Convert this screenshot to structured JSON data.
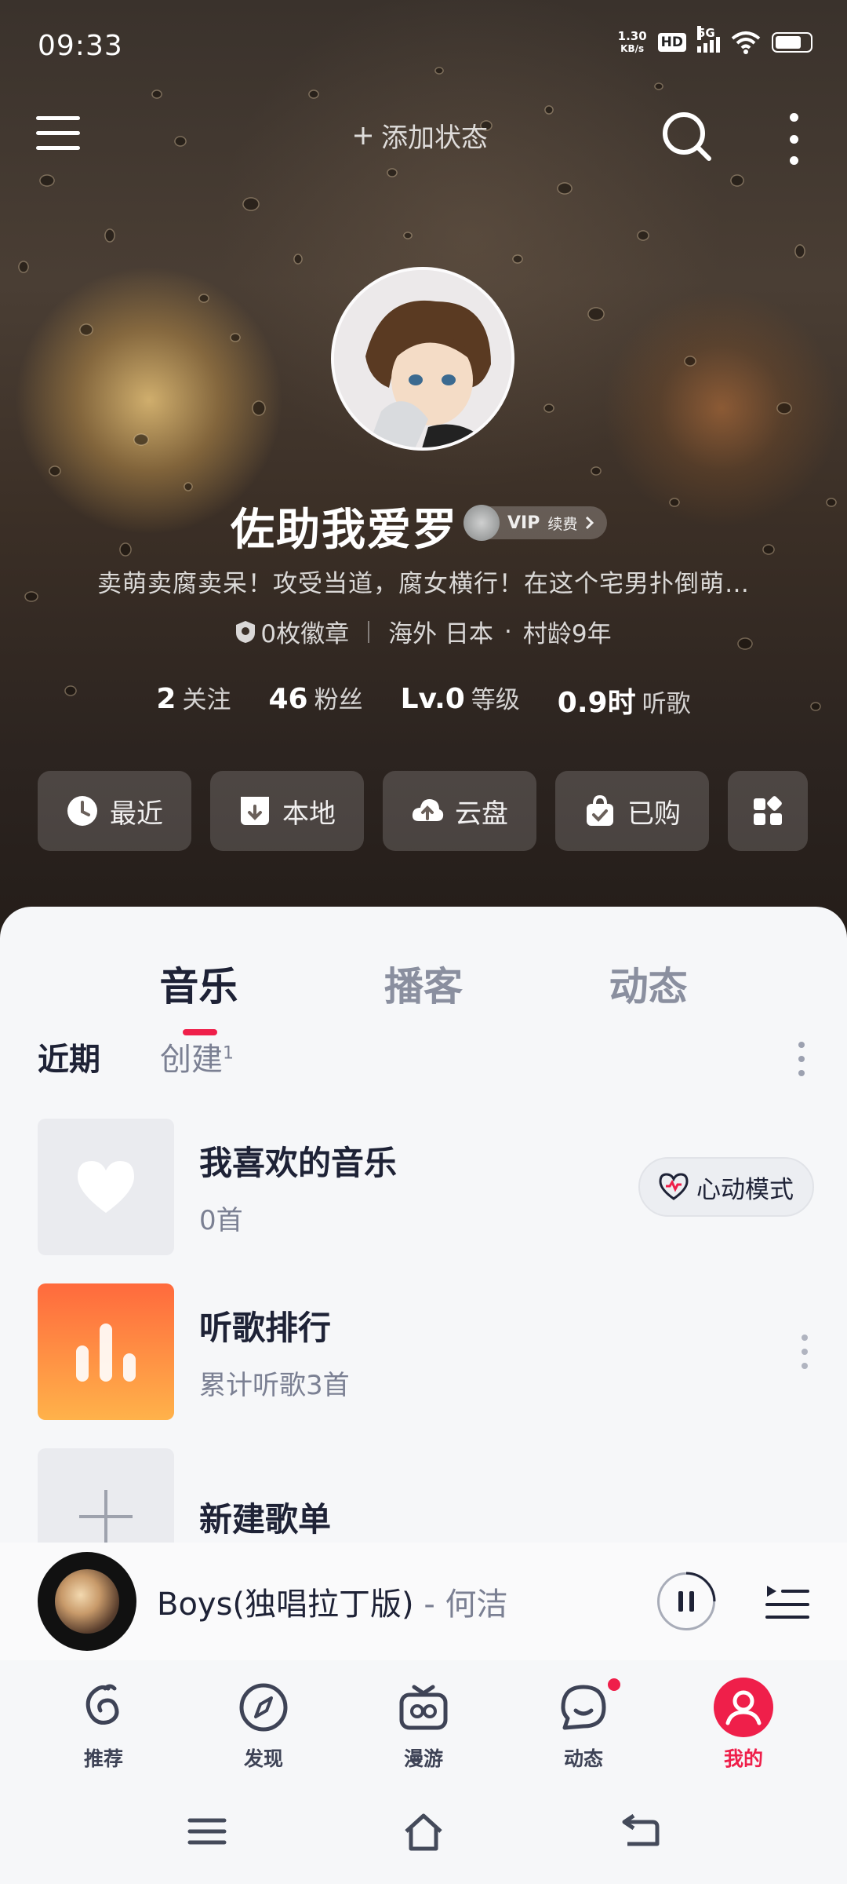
{
  "status_bar": {
    "time": "09:33",
    "net_speed_value": "1.30",
    "net_speed_unit": "KB/s",
    "hd": "HD",
    "network": "5G"
  },
  "top_bar": {
    "add_status_label": "添加状态"
  },
  "profile": {
    "username": "佐助我爱罗",
    "vip_label": "VIP",
    "vip_renew": "续费",
    "bio": "卖萌卖腐卖呆！攻受当道，腐女横行！在这个宅男扑倒萌…",
    "badges": "0枚徽章",
    "location": "海外 日本",
    "age": "村龄9年",
    "stats": [
      {
        "num": "2",
        "label": "关注"
      },
      {
        "num": "46",
        "label": "粉丝"
      },
      {
        "num": "Lv.0",
        "label": "等级"
      },
      {
        "num": "0.9时",
        "label": "听歌"
      }
    ]
  },
  "quick_actions": [
    {
      "label": "最近",
      "icon": "clock-icon"
    },
    {
      "label": "本地",
      "icon": "download-icon"
    },
    {
      "label": "云盘",
      "icon": "cloud-upload-icon"
    },
    {
      "label": "已购",
      "icon": "shopping-bag-icon"
    }
  ],
  "tabs": [
    "音乐",
    "播客",
    "动态"
  ],
  "subtabs": {
    "recent": "近期",
    "created": "创建",
    "created_count": "1"
  },
  "playlists": [
    {
      "title": "我喜欢的音乐",
      "sub": "0首",
      "action": "心动模式"
    },
    {
      "title": "听歌排行",
      "sub": "累计听歌3首"
    },
    {
      "title": "新建歌单"
    }
  ],
  "player": {
    "song": "Boys(独唱拉丁版)",
    "separator": " - ",
    "artist": "何洁"
  },
  "bottom_nav": [
    {
      "label": "推荐",
      "icon": "netease-logo-icon"
    },
    {
      "label": "发现",
      "icon": "compass-icon"
    },
    {
      "label": "漫游",
      "icon": "radio-icon"
    },
    {
      "label": "动态",
      "icon": "chat-icon"
    },
    {
      "label": "我的",
      "icon": "user-icon"
    }
  ],
  "colors": {
    "accent": "#ef1f4a",
    "text_primary": "#1e2236",
    "text_secondary": "#7b8093"
  }
}
